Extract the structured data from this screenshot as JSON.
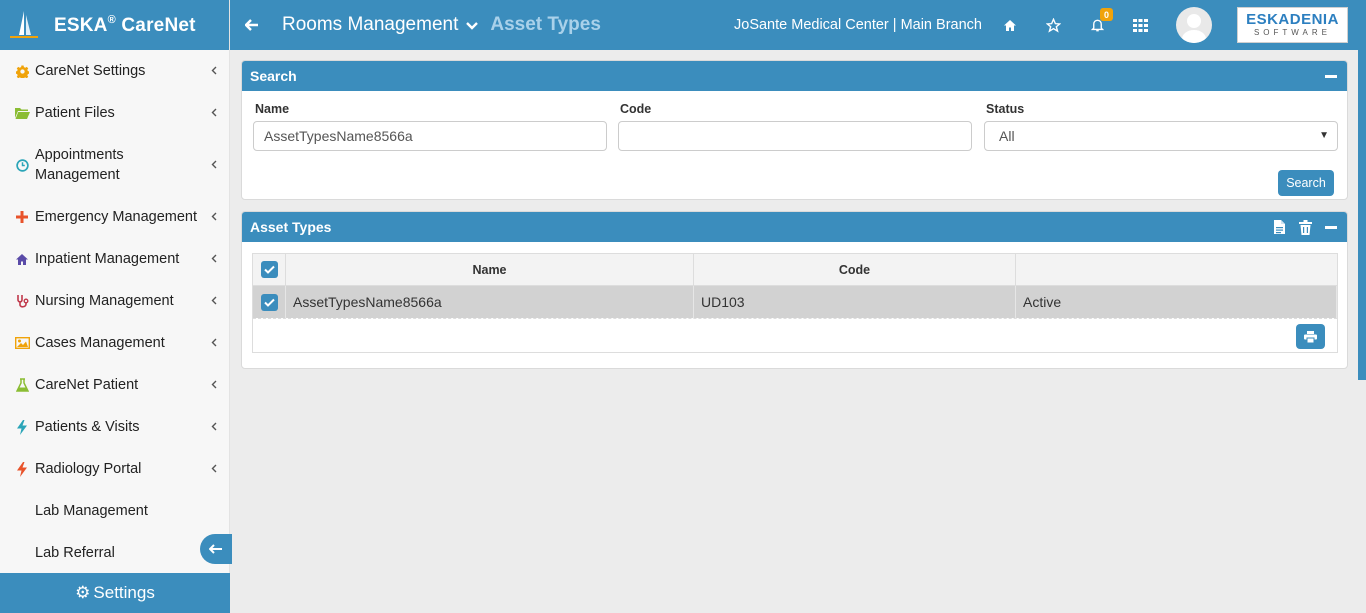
{
  "app": {
    "title": "ESKA",
    "title_suffix": "CareNet",
    "registered": "®"
  },
  "header": {
    "breadcrumb_main": "Rooms Management",
    "breadcrumb_sub": "Asset Types",
    "organization": "JoSante Medical Center | Main Branch",
    "notification_count": "0",
    "company_logo_top": "ESKADENIA",
    "company_logo_bottom": "SOFTWARE"
  },
  "sidebar": {
    "items": [
      {
        "label": "CareNet Settings",
        "icon": "gear-icon",
        "color": "#f0a30a"
      },
      {
        "label": "Patient Files",
        "icon": "folder-icon",
        "color": "#8bbd34"
      },
      {
        "label": "Appointments Management",
        "icon": "clock-icon",
        "color": "#2ba5b8"
      },
      {
        "label": "Emergency Management",
        "icon": "plus-icon",
        "color": "#e8532b"
      },
      {
        "label": "Inpatient Management",
        "icon": "home-icon",
        "color": "#5a4ba8"
      },
      {
        "label": "Nursing Management",
        "icon": "stethoscope-icon",
        "color": "#c0394b"
      },
      {
        "label": "Cases Management",
        "icon": "image-icon",
        "color": "#f0a30a"
      },
      {
        "label": "CareNet Patient",
        "icon": "flask-icon",
        "color": "#8bbd34"
      },
      {
        "label": "Patients & Visits",
        "icon": "bolt-icon",
        "color": "#2ba5b8"
      },
      {
        "label": "Radiology Portal",
        "icon": "bolt-icon",
        "color": "#e8532b"
      },
      {
        "label": "Lab Management",
        "icon": "",
        "color": ""
      },
      {
        "label": "Lab Referral",
        "icon": "",
        "color": ""
      }
    ],
    "settings_label": "Settings",
    "collapse_arrow": "🡐"
  },
  "search": {
    "title": "Search",
    "name_label": "Name",
    "name_value": "AssetTypesName8566a",
    "code_label": "Code",
    "code_value": "",
    "status_label": "Status",
    "status_value": "All",
    "search_button": "Search"
  },
  "asset_types": {
    "title": "Asset Types",
    "columns": [
      "Name",
      "Code",
      ""
    ],
    "rows": [
      {
        "name": "AssetTypesName8566a",
        "code": "UD103",
        "status": "Active",
        "checked": true
      }
    ]
  },
  "colors": {
    "primary": "#3b8dbd",
    "breadcrumb_sub": "#a9d1ea",
    "selected_row": "#d2d2d2"
  }
}
